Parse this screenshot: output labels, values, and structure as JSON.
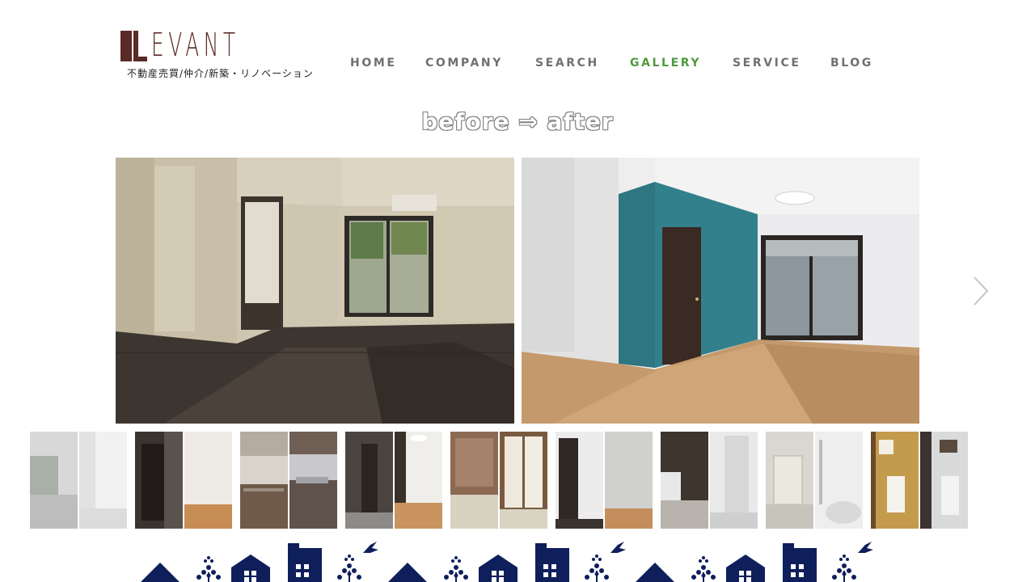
{
  "header": {
    "logo_text": "EVANT",
    "logo_subtitle": "不動産売買/仲介/新築・リノベーション",
    "nav": [
      {
        "label": "HOME",
        "active": false
      },
      {
        "label": "COMPANY",
        "active": false
      },
      {
        "label": "SEARCH",
        "active": false
      },
      {
        "label": "GALLERY",
        "active": true
      },
      {
        "label": "SERVICE",
        "active": false
      },
      {
        "label": "BLOG",
        "active": false
      }
    ]
  },
  "gallery": {
    "title": "before ⇒ after",
    "main_before_alt": "before",
    "main_after_alt": "after",
    "next_icon": "chevron-right-icon",
    "thumbnails": [
      {
        "room": "living-room"
      },
      {
        "room": "door-hallway"
      },
      {
        "room": "kitchen"
      },
      {
        "room": "corridor"
      },
      {
        "room": "closet"
      },
      {
        "room": "wall-door"
      },
      {
        "room": "washroom"
      },
      {
        "room": "bathroom"
      },
      {
        "room": "toilet"
      }
    ]
  },
  "colors": {
    "brand": "#5a2a26",
    "nav_text": "#707070",
    "nav_active": "#4e9a3e",
    "footer_navy": "#0f1f5c"
  }
}
